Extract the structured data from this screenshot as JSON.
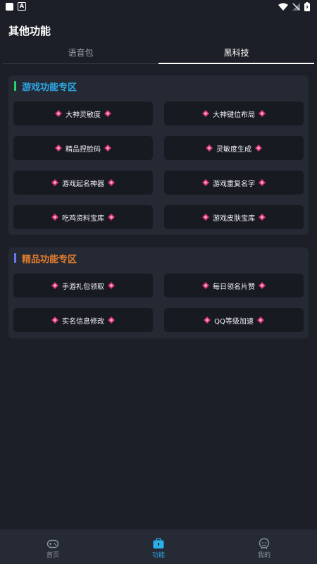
{
  "page_title": "其他功能",
  "tabs": [
    {
      "label": "语音包",
      "active": false
    },
    {
      "label": "黑科技",
      "active": true
    }
  ],
  "sections": [
    {
      "title": "游戏功能专区",
      "title_color": "#2ea9e6",
      "bar_color": "#27d36b",
      "items": [
        "大神灵敏度",
        "大神键位布局",
        "精品捏脸码",
        "灵敏度生成",
        "游戏起名神器",
        "游戏重复名字",
        "吃鸡资料宝库",
        "游戏皮肤宝库"
      ]
    },
    {
      "title": "精品功能专区",
      "title_color": "#e07b2c",
      "bar_color": "#6b78e6",
      "items": [
        "手游礼包领取",
        "每日领名片赞",
        "实名信息修改",
        "QQ等级加速"
      ]
    }
  ],
  "bottom_nav": [
    {
      "label": "首页",
      "icon": "gamepad-icon",
      "active": false
    },
    {
      "label": "功能",
      "icon": "toolbox-icon",
      "active": true
    },
    {
      "label": "我的",
      "icon": "face-icon",
      "active": false
    }
  ],
  "colors": {
    "background": "#1c1f27",
    "card": "#242934",
    "button": "#171a21",
    "gem": "#d6336c",
    "nav_active": "#29b0ea",
    "nav_inactive": "#8d93a0"
  }
}
